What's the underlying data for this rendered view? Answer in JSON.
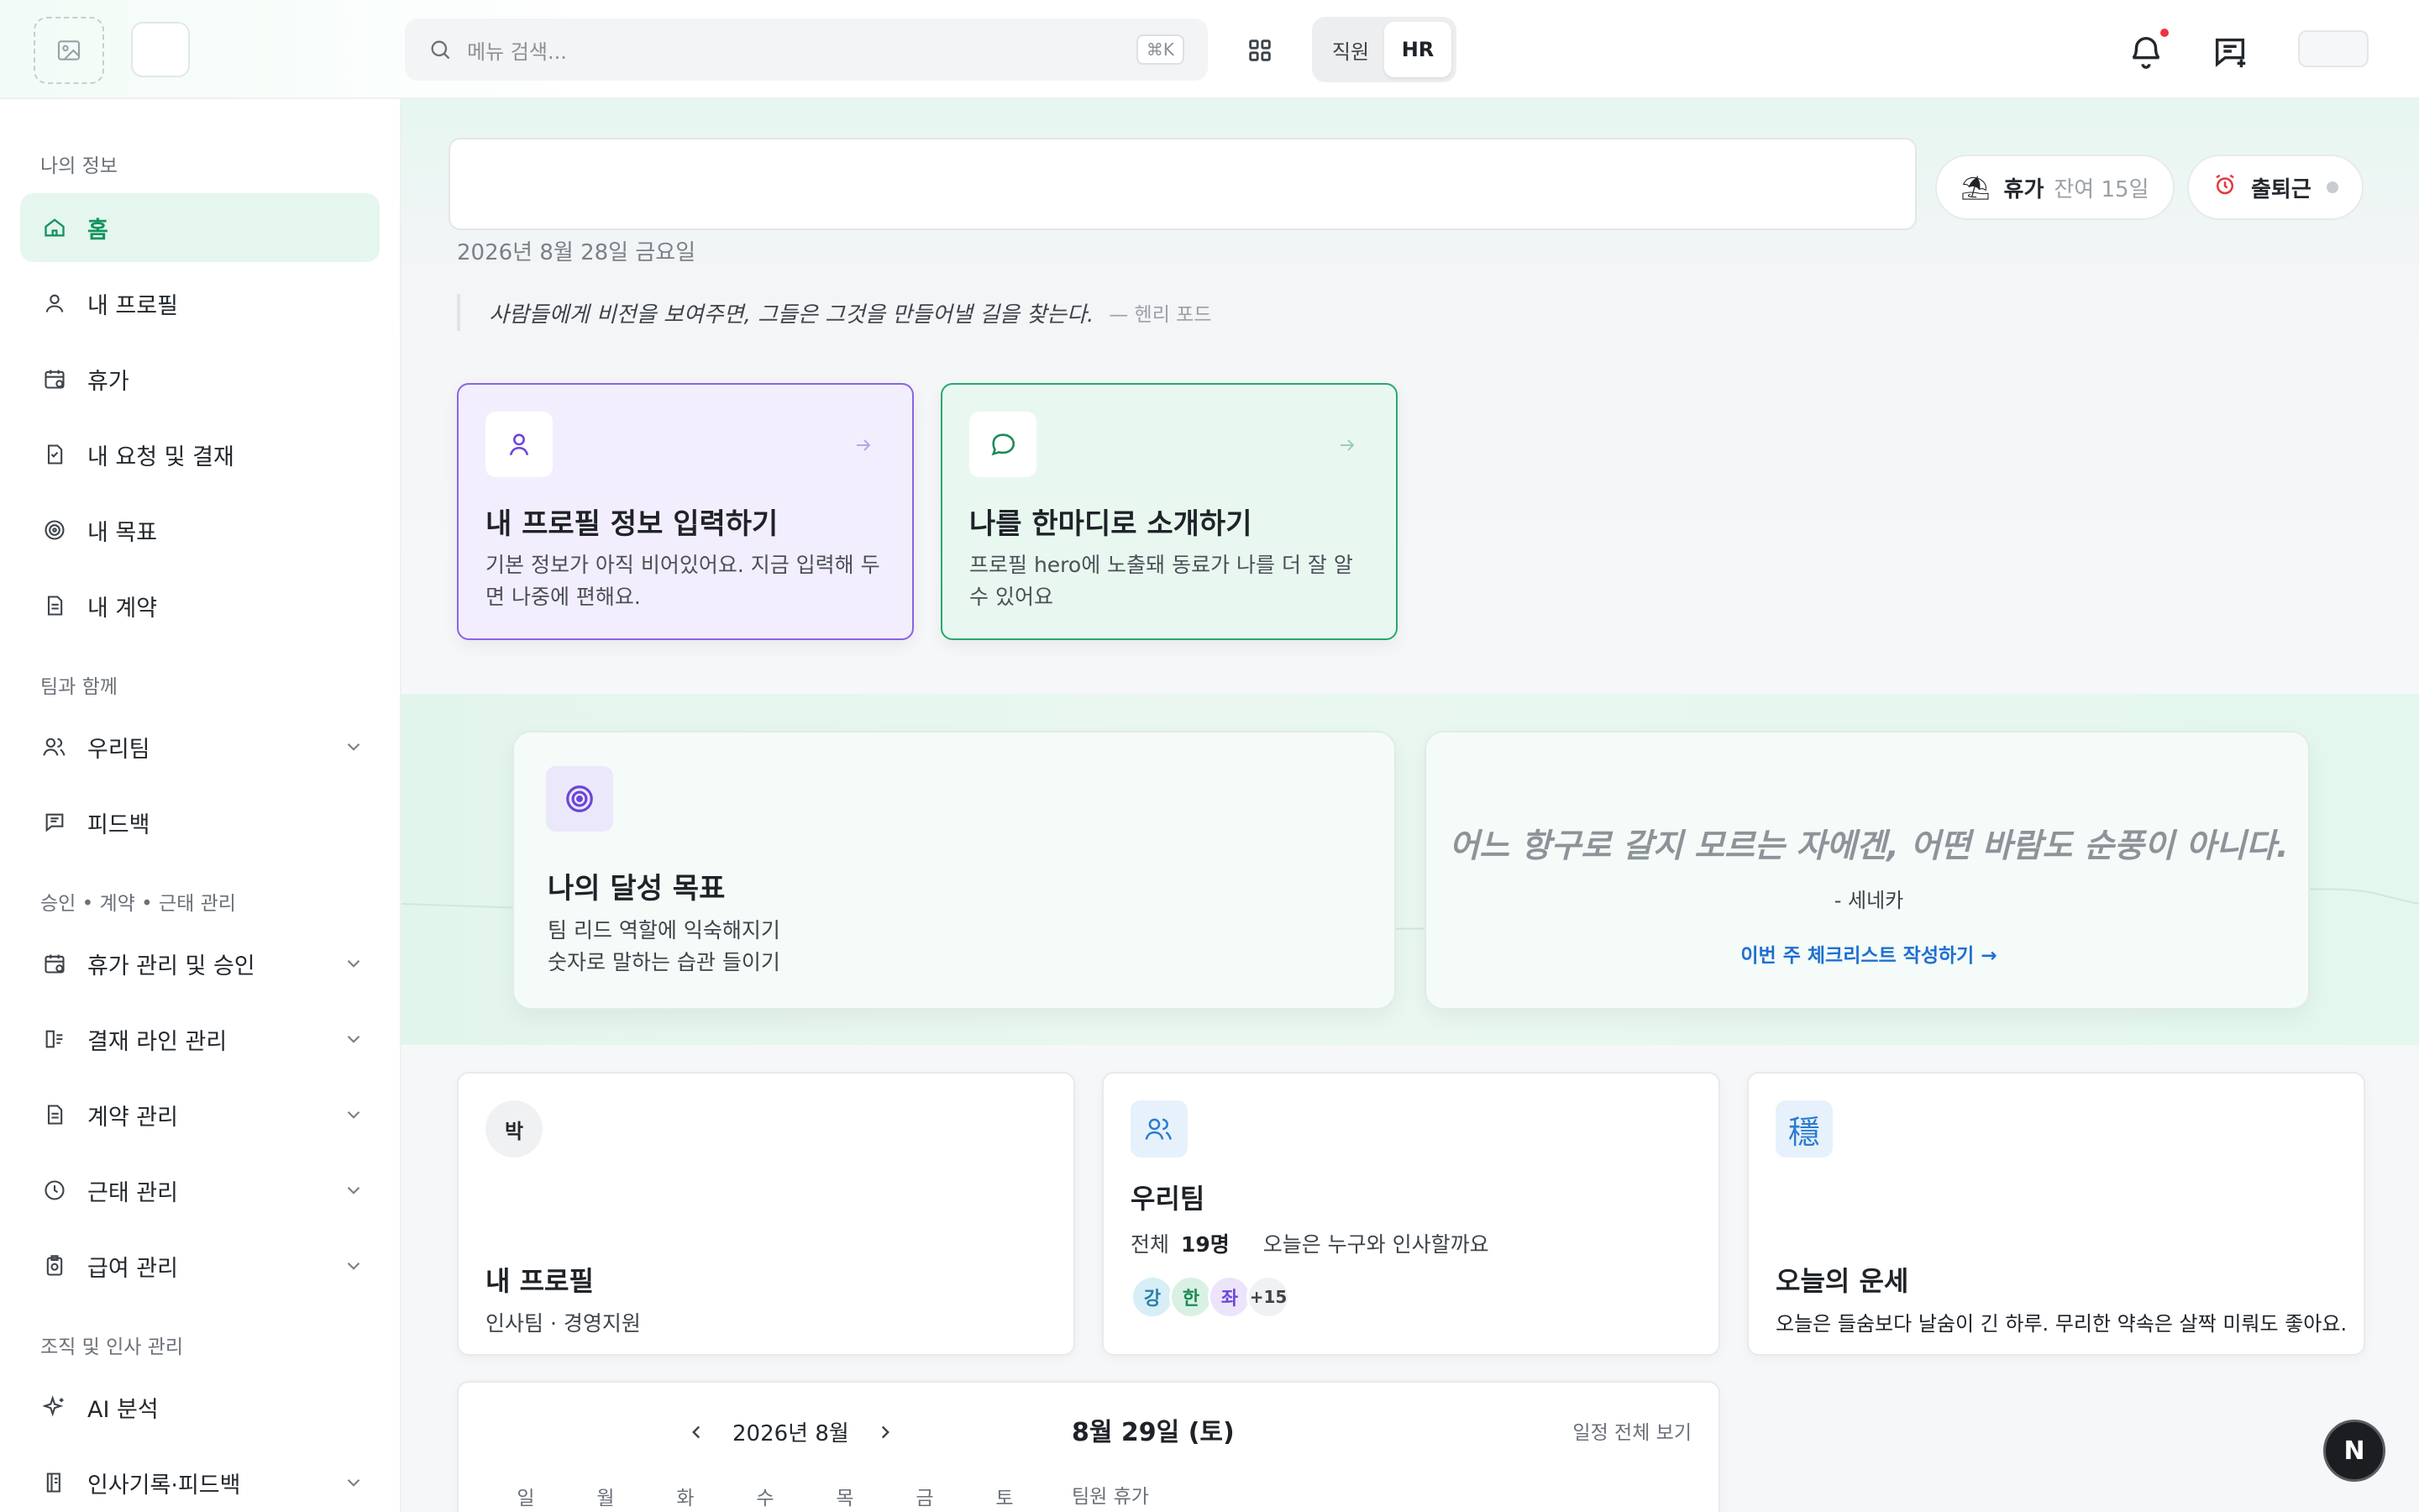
{
  "topbar": {
    "search_placeholder": "메뉴 검색...",
    "search_shortcut": "⌘K",
    "roles": [
      "직원",
      "HR"
    ],
    "active_role": "HR",
    "icons": [
      "image-icon",
      "search-icon",
      "grid-icon",
      "bell-icon",
      "message-plus-icon"
    ]
  },
  "sidebar": {
    "sections": [
      {
        "label": "나의 정보",
        "items": [
          {
            "label": "홈",
            "icon": "home-icon",
            "active": true
          },
          {
            "label": "내 프로필",
            "icon": "user-icon"
          },
          {
            "label": "휴가",
            "icon": "calendar-icon"
          },
          {
            "label": "내 요청 및 결재",
            "icon": "file-check-icon"
          },
          {
            "label": "내 목표",
            "icon": "target-icon"
          },
          {
            "label": "내 계약",
            "icon": "document-icon"
          }
        ]
      },
      {
        "label": "팀과 함께",
        "items": [
          {
            "label": "우리팀",
            "icon": "users-icon",
            "expandable": true
          },
          {
            "label": "피드백",
            "icon": "message-icon"
          }
        ]
      },
      {
        "label": "승인 • 계약 • 근태 관리",
        "items": [
          {
            "label": "휴가 관리 및 승인",
            "icon": "calendar-icon",
            "expandable": true
          },
          {
            "label": "결재 라인 관리",
            "icon": "approval-line-icon",
            "expandable": true
          },
          {
            "label": "계약 관리",
            "icon": "document-icon",
            "expandable": true
          },
          {
            "label": "근태 관리",
            "icon": "clock-icon",
            "expandable": true
          },
          {
            "label": "급여 관리",
            "icon": "payroll-icon",
            "expandable": true
          }
        ]
      },
      {
        "label": "조직 및 인사 관리",
        "items": [
          {
            "label": "AI 분석",
            "icon": "sparkles-icon"
          },
          {
            "label": "인사기록·피드백",
            "icon": "record-icon",
            "expandable": true
          }
        ]
      }
    ]
  },
  "main": {
    "date": "2026년 8월 28일 금요일",
    "quote": "사람들에게 비전을 보여주면, 그들은 그것을 만들어낼 길을 찾는다.",
    "quote_author": "— 헨리 포드",
    "vacation_pill": {
      "label": "휴가",
      "remaining": "잔여 15일"
    },
    "attendance_pill": {
      "label": "출퇴근"
    },
    "task_cards": [
      {
        "title": "내 프로필 정보 입력하기",
        "desc": "기본 정보가 아직 비어있어요. 지금 입력해 두면 나중에 편해요.",
        "color": "#8a63e6"
      },
      {
        "title": "나를 한마디로 소개하기",
        "desc": "프로필 hero에 노출돼 동료가 나를 더 잘 알 수 있어요",
        "color": "#26a96d"
      }
    ],
    "goal_card": {
      "title": "나의 달성 목표",
      "goals": [
        "팀 리드 역할에 익숙해지기",
        "숫자로 말하는 습관 들이기"
      ]
    },
    "quote_card": {
      "quote": "어느 항구로 갈지 모르는 자에겐, 어떤 바람도 순풍이 아니다.",
      "author": "- 세네카",
      "link": "이번 주 체크리스트 작성하기 →"
    },
    "profile_card": {
      "avatar": "박",
      "title": "내 프로필",
      "subtitle": "인사팀 · 경영지원"
    },
    "team_card": {
      "title": "우리팀",
      "total_label": "전체",
      "total_count": "19명",
      "greeting": "오늘은 누구와 인사할까요",
      "avatars": [
        "강",
        "한",
        "좌"
      ],
      "more": "+15"
    },
    "fortune_card": {
      "icon_char": "穩",
      "title": "오늘의 운세",
      "text": "오늘은 들숨보다 날숨이 긴 하루. 무리한 약속은 살짝 미뤄도 좋아요."
    },
    "calendar": {
      "month": "2026년 8월",
      "weekdays": [
        "일",
        "월",
        "화",
        "수",
        "목",
        "금",
        "토"
      ],
      "selected_day": "8월 29일 (토)",
      "view_all": "일정 전체 보기",
      "section": "팀원 휴가"
    },
    "fab_label": "N"
  }
}
